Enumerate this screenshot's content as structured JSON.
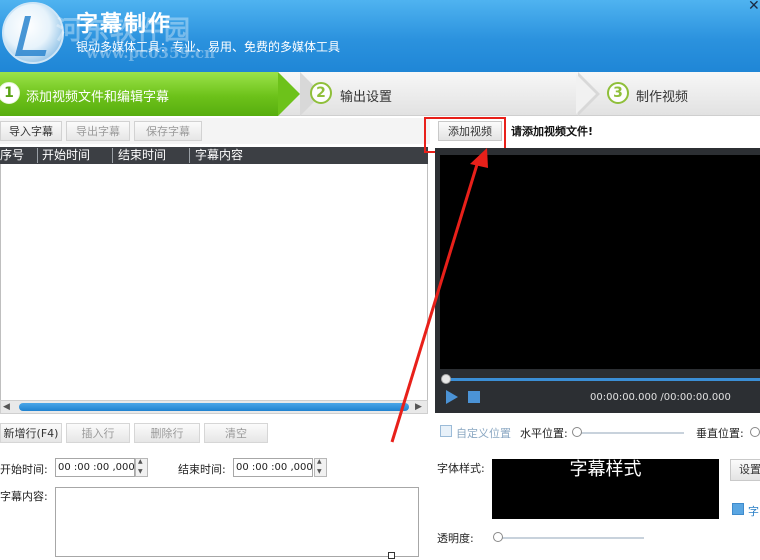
{
  "header": {
    "title": "字幕制作",
    "subtitle": "银动多媒体工具：专业、易用、免费的多媒体工具",
    "watermark_line1": "河东软件园",
    "watermark_line2": "www.pc0359.cn"
  },
  "steps": [
    {
      "num": "1",
      "label": "添加视频文件和编辑字幕"
    },
    {
      "num": "2",
      "label": "输出设置"
    },
    {
      "num": "3",
      "label": "制作视频"
    }
  ],
  "left_toolbar": {
    "import": "导入字幕",
    "export": "导出字幕",
    "save": "保存字幕"
  },
  "grid": {
    "columns": [
      "序号",
      "开始时间",
      "结束时间",
      "字幕内容"
    ]
  },
  "row_actions": {
    "new_row": "新增行(F4)",
    "insert_row": "插入行",
    "delete_row": "删除行",
    "clear": "清空"
  },
  "editor": {
    "start_label": "开始时间:",
    "start_value": "00 :00 :00 ,000",
    "end_label": "结束时间:",
    "end_value": "00 :00 :00 ,000",
    "content_label": "字幕内容:"
  },
  "video": {
    "add_button": "添加视频",
    "prompt": "请添加视频文件!",
    "time": "00:00:00.000 /00:00:00.000"
  },
  "position": {
    "custom": "自定义位置",
    "horizontal": "水平位置:",
    "vertical": "垂直位置:"
  },
  "font": {
    "label": "字体样式:",
    "preview": "字幕样式",
    "settings_button": "设置",
    "partial_check_label": "字",
    "transparency_label": "透明度:"
  }
}
